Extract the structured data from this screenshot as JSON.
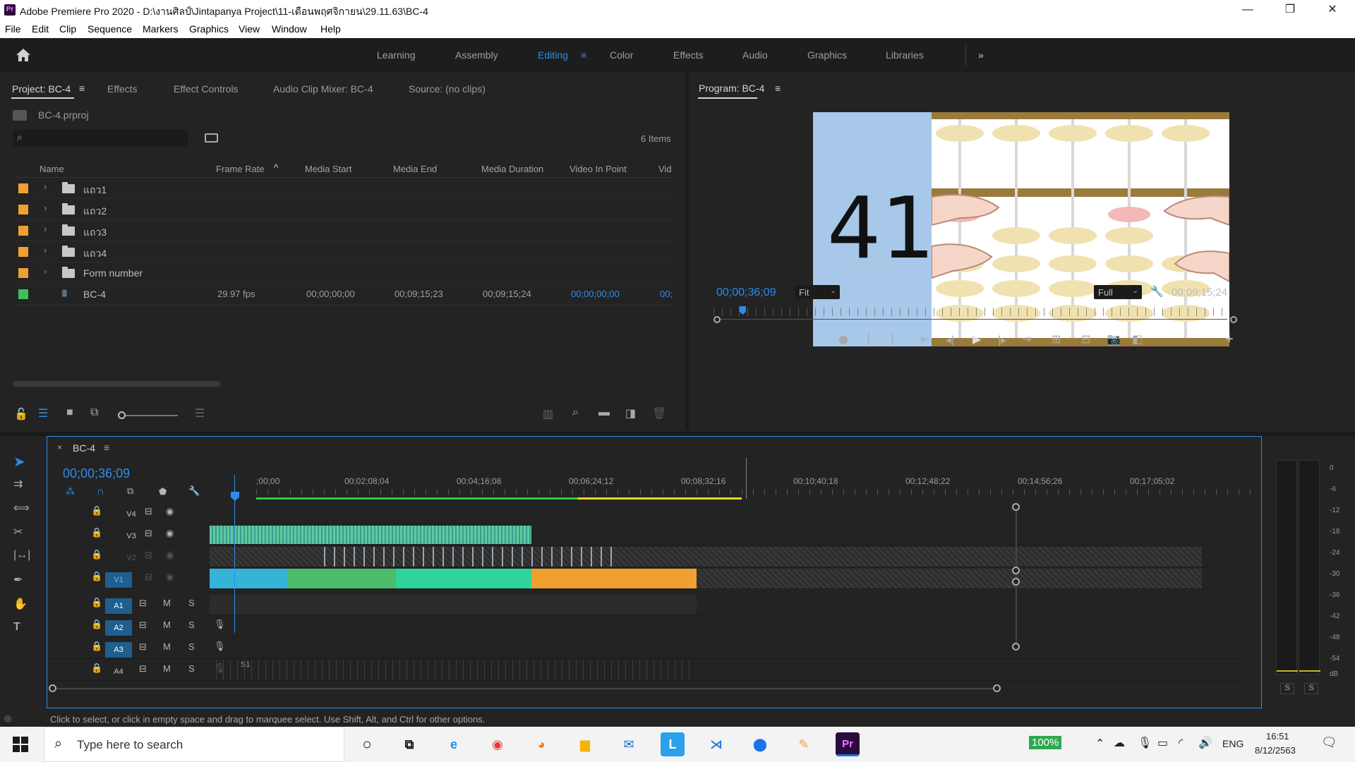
{
  "window": {
    "title": "Adobe Premiere Pro 2020 - D:\\งานศิลป์\\Jintapanya Project\\11-เดือนพฤศจิกายน\\29.11.63\\BC-4",
    "logo_text": "Pr"
  },
  "menu": [
    "File",
    "Edit",
    "Clip",
    "Sequence",
    "Markers",
    "Graphics",
    "View",
    "Window",
    "Help"
  ],
  "workspaces": [
    "Learning",
    "Assembly",
    "Editing",
    "Color",
    "Effects",
    "Audio",
    "Graphics",
    "Libraries"
  ],
  "active_workspace": "Editing",
  "project_panel": {
    "tabs": [
      "Project: BC-4",
      "Effects",
      "Effect Controls",
      "Audio Clip Mixer: BC-4",
      "Source: (no clips)"
    ],
    "file": "BC-4.prproj",
    "items_count": "6 Items",
    "columns": [
      "Name",
      "Frame Rate",
      "Media Start",
      "Media End",
      "Media Duration",
      "Video In Point",
      "Vid"
    ],
    "rows": [
      {
        "name": "แถว1",
        "type": "folder",
        "color": "#f0a030"
      },
      {
        "name": "แถว2",
        "type": "folder",
        "color": "#f0a030"
      },
      {
        "name": "แถว3",
        "type": "folder",
        "color": "#f0a030"
      },
      {
        "name": "แถว4",
        "type": "folder",
        "color": "#f0a030"
      },
      {
        "name": "Form number",
        "type": "folder",
        "color": "#f0a030"
      },
      {
        "name": "BC-4",
        "type": "sequence",
        "color": "#3dbf5a",
        "frame_rate": "29.97 fps",
        "media_start": "00;00;00;00",
        "media_end": "00;09;15;23",
        "media_duration": "00;09;15;24",
        "video_in": "00;00;00;00",
        "vid": "00;"
      }
    ]
  },
  "program_panel": {
    "title": "Program: BC-4",
    "overlay_number": "41",
    "timecode": "00;00;36;09",
    "fit": "Fit",
    "quality": "Full",
    "duration": "00;09;15;24",
    "playhead_fraction": 0.057
  },
  "timeline": {
    "sequence": "BC-4",
    "timecode": "00;00;36;09",
    "ruler": [
      ";00;00",
      "00;02;08;04",
      "00;04;16;08",
      "00;06;24;12",
      "00;08;32;16",
      "00;10;40;18",
      "00;12;48;22",
      "00;14;56;26",
      "00;17;05;02"
    ],
    "video_tracks": [
      "V4",
      "V3",
      "V2",
      "V1"
    ],
    "audio_tracks": [
      "A1",
      "A2",
      "A3",
      "A4"
    ],
    "track_m": "M",
    "track_s": "S",
    "a4_extra": "S1"
  },
  "meter": {
    "labels": [
      "0",
      "-6",
      "-12",
      "-18",
      "-24",
      "-30",
      "-36",
      "-42",
      "-48",
      "-54",
      "dB"
    ],
    "solo": [
      "S",
      "S"
    ]
  },
  "status_text": "Click to select, or click in empty space and drag to marquee select. Use Shift, Alt, and Ctrl for other options.",
  "taskbar": {
    "search_placeholder": "Type here to search",
    "battery": "100%",
    "lang": "ENG",
    "time": "16:51",
    "date": "8/12/2563"
  }
}
